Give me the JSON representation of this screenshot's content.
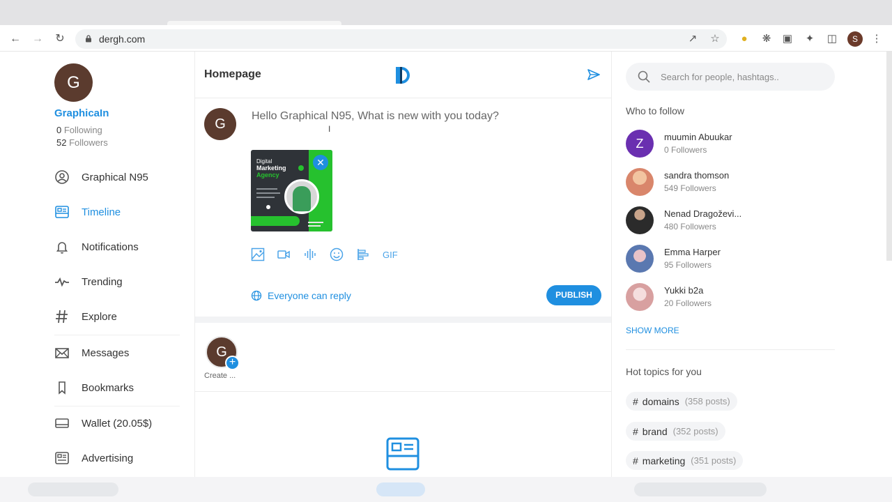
{
  "browser": {
    "url": "dergh.com",
    "profile_initial": "S"
  },
  "user": {
    "initial": "G",
    "name": "GraphicaIn",
    "following_count": "0",
    "following_label": "Following",
    "followers_count": "52",
    "followers_label": "Followers"
  },
  "nav": {
    "items": [
      {
        "label": "Graphical N95",
        "icon": "profile-icon"
      },
      {
        "label": "Timeline",
        "icon": "timeline-icon",
        "active": true
      },
      {
        "label": "Notifications",
        "icon": "bell-icon"
      },
      {
        "label": "Trending",
        "icon": "trending-icon"
      },
      {
        "label": "Explore",
        "icon": "hashtag-icon"
      },
      {
        "label": "Messages",
        "icon": "envelope-icon"
      },
      {
        "label": "Bookmarks",
        "icon": "bookmark-icon"
      },
      {
        "label": "Wallet",
        "icon": "wallet-icon"
      },
      {
        "label": "Advertising",
        "icon": "advertising-icon"
      }
    ],
    "wallet_amount": "(20.05$)"
  },
  "main": {
    "title": "Homepage",
    "composer": {
      "avatar_initial": "G",
      "prompt": "Hello Graphical N95, What is new with you today?",
      "attachment": {
        "line1": "Digital",
        "line2": "Marketing",
        "line3": "Agency"
      },
      "gif_label": "GIF",
      "reply_scope": "Everyone can reply",
      "publish_label": "PUBLISH"
    },
    "stories": {
      "avatar_initial": "G",
      "create_label": "Create ..."
    }
  },
  "right": {
    "search_placeholder": "Search for people, hashtags..",
    "who_to_follow_title": "Who to follow",
    "who_to_follow": [
      {
        "name": "muumin Abuukar",
        "followers": "0 Followers",
        "initial": "Z",
        "color": "#6a2fb0"
      },
      {
        "name": "sandra thomson",
        "followers": "549 Followers",
        "color": "#d9866b"
      },
      {
        "name": "Nenad Dragoževi...",
        "followers": "480 Followers",
        "color": "#2b2b2b"
      },
      {
        "name": "Emma Harper",
        "followers": "95 Followers",
        "color": "#6a86b8"
      },
      {
        "name": "Yukki b2a",
        "followers": "20 Followers",
        "color": "#e8b8b8"
      }
    ],
    "show_more_label": "SHOW MORE",
    "hot_topics_title": "Hot topics for you",
    "hot_topics": [
      {
        "tag": "domains",
        "count": "(358 posts)"
      },
      {
        "tag": "brand",
        "count": "(352 posts)"
      },
      {
        "tag": "marketing",
        "count": "(351 posts)"
      }
    ]
  },
  "colors": {
    "accent": "#1f8fe0",
    "avatar": "#5b3b2e",
    "wallet_green": "#2fa44f"
  }
}
